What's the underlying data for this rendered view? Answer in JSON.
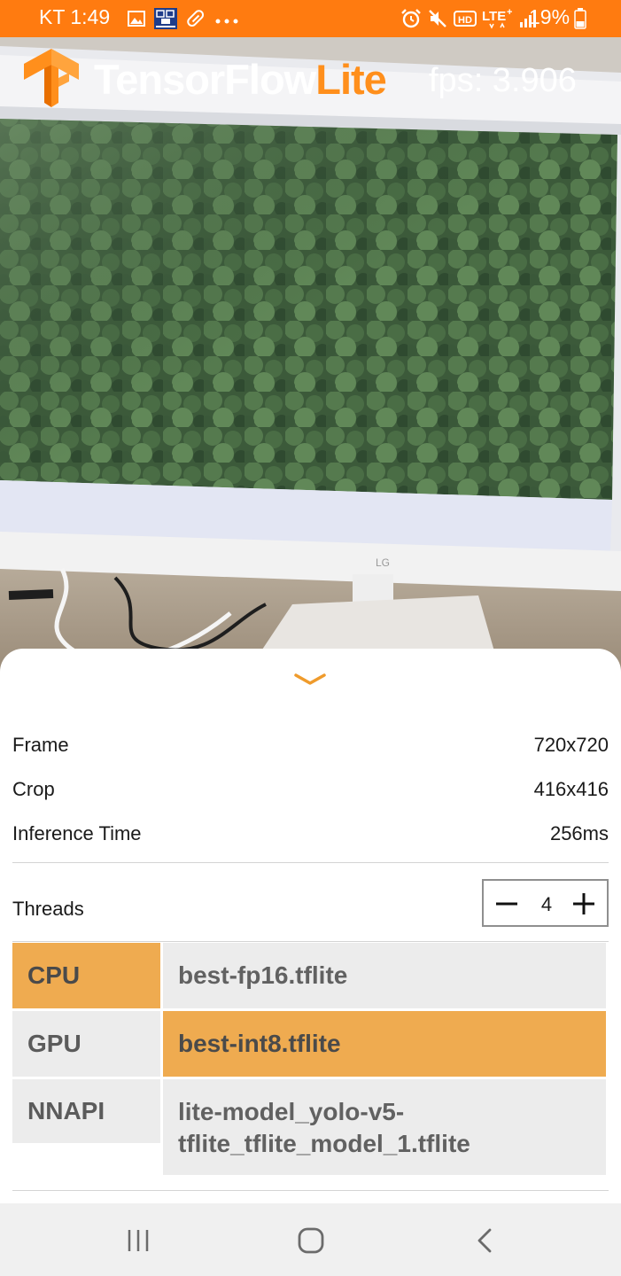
{
  "status_bar": {
    "carrier_time": "KT 1:49",
    "battery_percent": "19%",
    "left_icons": [
      "gallery-icon",
      "app-badge-icon",
      "pill-icon",
      "more-dots-icon"
    ],
    "right_icons": [
      "alarm-icon",
      "mute-icon",
      "hd-icon",
      "lte-icon",
      "signal-icon",
      "battery-icon"
    ],
    "background": "#ff7b10"
  },
  "header": {
    "app_name_main": "TensorFlow",
    "app_name_accent": "Lite",
    "fps_text": "fps: 3.906",
    "accent_color": "#ff8f1c"
  },
  "sheet": {
    "info": [
      {
        "label": "Frame",
        "value": "720x720"
      },
      {
        "label": "Crop",
        "value": "416x416"
      },
      {
        "label": "Inference Time",
        "value": "256ms"
      }
    ],
    "threads": {
      "label": "Threads",
      "value": "4"
    },
    "delegates": [
      {
        "label": "CPU",
        "selected": true
      },
      {
        "label": "GPU",
        "selected": false
      },
      {
        "label": "NNAPI",
        "selected": false
      }
    ],
    "models": [
      {
        "label": "best-fp16.tflite",
        "selected": false
      },
      {
        "label": "best-int8.tflite",
        "selected": true
      },
      {
        "label": "lite-model_yolo-v5-",
        "label2": "tflite_tflite_model_1.tflite",
        "selected": false
      }
    ],
    "selected_color": "#efab50",
    "unselected_color": "#ececec"
  },
  "nav_bar": {
    "buttons": [
      "recents-icon",
      "home-icon",
      "back-icon"
    ]
  }
}
